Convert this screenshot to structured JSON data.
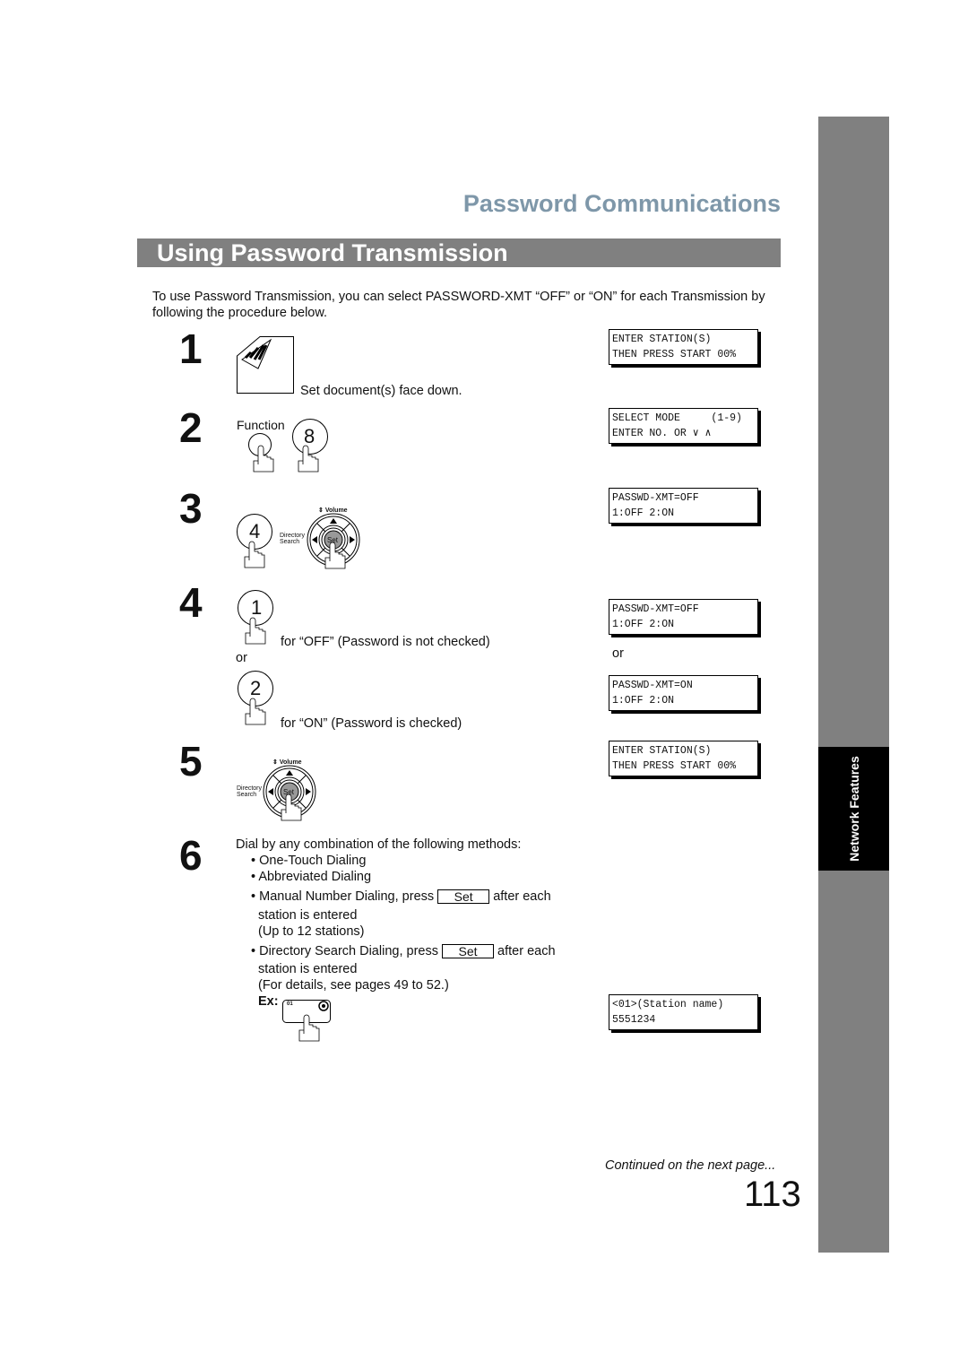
{
  "header": {
    "section_title": "Password Communications",
    "banner": "Using Password Transmission"
  },
  "intro": "To use Password Transmission, you can select PASSWORD-XMT “OFF” or “ON” for each Transmission by following the procedure below.",
  "side_tab": "Network Features",
  "steps": [
    {
      "number": "1",
      "text": "Set document(s) face down.",
      "lcd": [
        "ENTER STATION(S)",
        "THEN PRESS START 00%"
      ]
    },
    {
      "number": "2",
      "key_label": "Function",
      "key": "8",
      "lcd": [
        "SELECT MODE     (1-9)",
        "ENTER NO. OR ∨ ∧"
      ]
    },
    {
      "number": "3",
      "key": "4",
      "lcd": [
        "PASSWD-XMT=OFF",
        "1:OFF 2:ON"
      ]
    },
    {
      "number": "4",
      "key1": "1",
      "text1": "for “OFF” (Password is not checked)",
      "or": "or",
      "key2": "2",
      "text2": "for “ON” (Password is checked)",
      "lcd1": [
        "PASSWD-XMT=OFF",
        "1:OFF 2:ON"
      ],
      "lcd2": [
        "PASSWD-XMT=ON",
        "1:OFF 2:ON"
      ]
    },
    {
      "number": "5",
      "lcd": [
        "ENTER STATION(S)",
        "THEN PRESS START 00%"
      ]
    },
    {
      "number": "6",
      "lead": "Dial by any combination of the following methods:",
      "b1": "One-Touch Dialing",
      "b2": "Abbreviated Dialing",
      "b3a": "Manual Number Dialing, press",
      "b3b": "after each",
      "b3c": "station is entered",
      "b3d": "(Up to 12 stations)",
      "b4a": "Directory Search Dialing, press",
      "b4b": "after each",
      "b4c": "station is entered",
      "b4d": "(For details, see pages 49 to 52.)",
      "ex": "Ex:",
      "onetouch": "01",
      "lcd": [
        "<01>(Station name)",
        "5551234"
      ]
    }
  ],
  "nav_pad": {
    "volume": "Volume",
    "directory": "Directory",
    "search": "Search",
    "set": "Set"
  },
  "set_key": "Set",
  "footer": {
    "continued": "Continued on the next page...",
    "page": "113"
  },
  "colors": {
    "title": "#7e97a9",
    "banner": "#808080",
    "side": "#808080",
    "tab": "#000000"
  }
}
